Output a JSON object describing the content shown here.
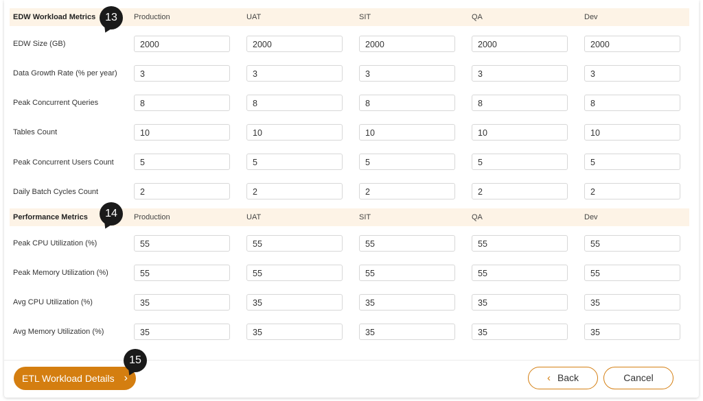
{
  "columns": [
    "Production",
    "UAT",
    "SIT",
    "QA",
    "Dev"
  ],
  "edw": {
    "title": "EDW Workload Metrics",
    "callout": "13",
    "rows": [
      {
        "label": "EDW Size (GB)",
        "values": [
          "2000",
          "2000",
          "2000",
          "2000",
          "2000"
        ]
      },
      {
        "label": "Data Growth Rate (% per year)",
        "values": [
          "3",
          "3",
          "3",
          "3",
          "3"
        ]
      },
      {
        "label": "Peak Concurrent Queries",
        "values": [
          "8",
          "8",
          "8",
          "8",
          "8"
        ]
      },
      {
        "label": "Tables Count",
        "values": [
          "10",
          "10",
          "10",
          "10",
          "10"
        ]
      },
      {
        "label": "Peak Concurrent Users Count",
        "values": [
          "5",
          "5",
          "5",
          "5",
          "5"
        ]
      },
      {
        "label": "Daily Batch Cycles Count",
        "values": [
          "2",
          "2",
          "2",
          "2",
          "2"
        ]
      }
    ]
  },
  "perf": {
    "title": "Performance Metrics",
    "callout": "14",
    "rows": [
      {
        "label": "Peak CPU Utilization (%)",
        "values": [
          "55",
          "55",
          "55",
          "55",
          "55"
        ]
      },
      {
        "label": "Peak Memory Utilization (%)",
        "values": [
          "55",
          "55",
          "55",
          "55",
          "55"
        ]
      },
      {
        "label": "Avg CPU Utilization (%)",
        "values": [
          "35",
          "35",
          "35",
          "35",
          "35"
        ]
      },
      {
        "label": "Avg Memory Utilization (%)",
        "values": [
          "35",
          "35",
          "35",
          "35",
          "35"
        ]
      }
    ]
  },
  "footer": {
    "next_label": "ETL Workload Details",
    "next_callout": "15",
    "back_label": "Back",
    "cancel_label": "Cancel",
    "chevron_right": "›",
    "chevron_left": "‹"
  },
  "colors": {
    "accent": "#d47e10",
    "header_bg": "#fdf3e6",
    "callout_bg": "#1a1a1a"
  }
}
